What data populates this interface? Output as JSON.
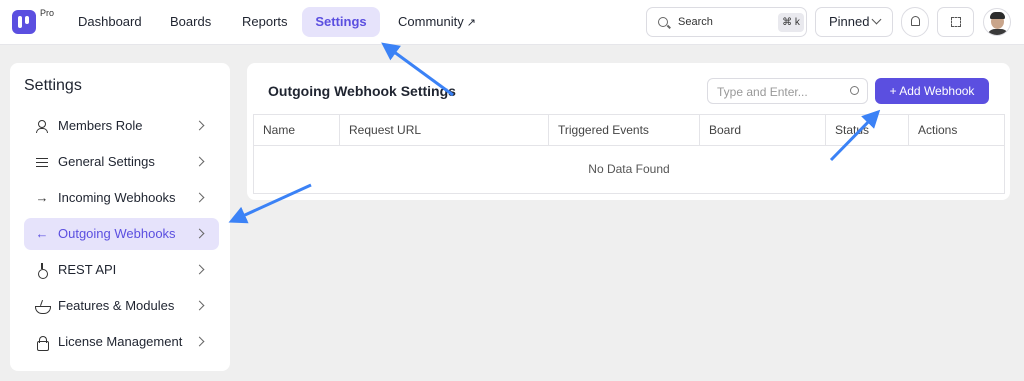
{
  "app": {
    "badge": "Pro"
  },
  "nav": {
    "items": [
      {
        "label": "Dashboard"
      },
      {
        "label": "Boards"
      },
      {
        "label": "Reports"
      },
      {
        "label": "Settings",
        "active": true
      },
      {
        "label": "Community",
        "external_icon": "external-link-icon",
        "external_glyph": "↗"
      }
    ]
  },
  "header": {
    "search_label": "Search",
    "search_shortcut": "⌘ k",
    "pinned_label": "Pinned"
  },
  "sidebar": {
    "title": "Settings",
    "items": [
      {
        "label": "Members Role",
        "icon": "members-icon"
      },
      {
        "label": "General Settings",
        "icon": "sliders-icon"
      },
      {
        "label": "Incoming Webhooks",
        "icon": "arrow-right-icon",
        "glyph": "→"
      },
      {
        "label": "Outgoing Webhooks",
        "icon": "arrow-left-icon",
        "glyph": "←",
        "active": true
      },
      {
        "label": "REST API",
        "icon": "plug-icon"
      },
      {
        "label": "Features & Modules",
        "icon": "bowl-icon"
      },
      {
        "label": "License Management",
        "icon": "lock-icon"
      }
    ]
  },
  "main": {
    "title": "Outgoing Webhook Settings",
    "filter_placeholder": "Type and Enter...",
    "add_button": "+ Add Webhook",
    "table": {
      "columns": [
        "Name",
        "Request URL",
        "Triggered Events",
        "Board",
        "Status",
        "Actions"
      ],
      "empty_text": "No Data Found"
    }
  },
  "colors": {
    "accent": "#5b4fe0",
    "accent_bg": "#e6e3fb",
    "annotation_arrow": "#3b82f6"
  }
}
